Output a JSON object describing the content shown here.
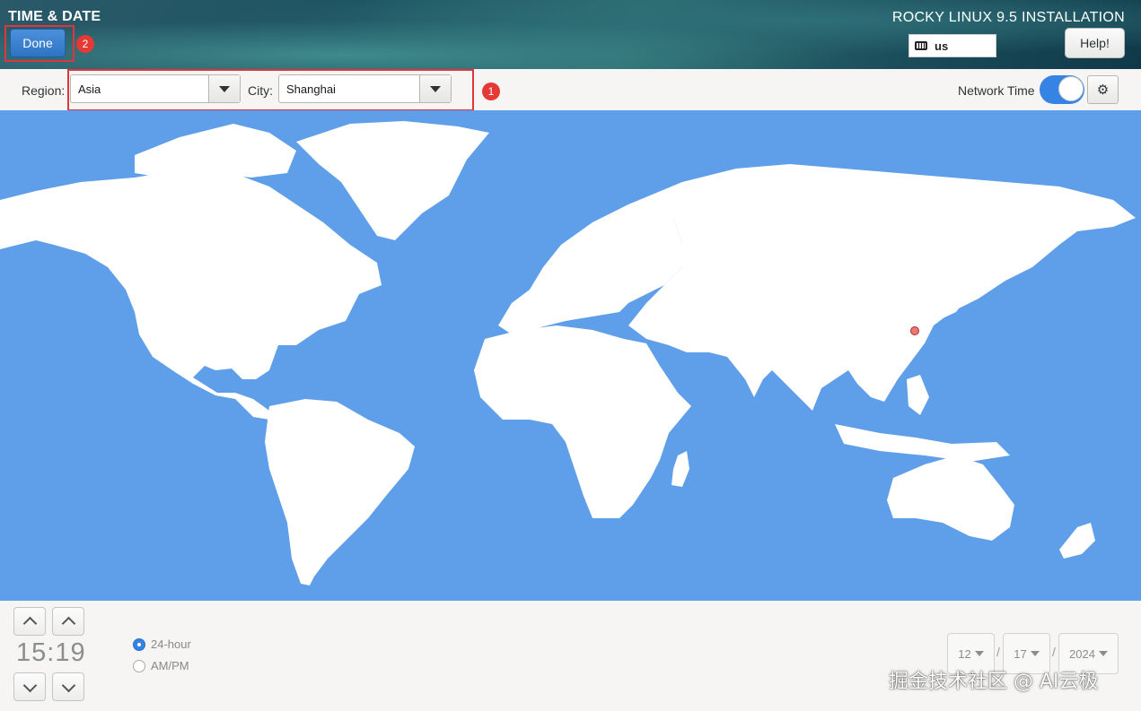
{
  "header": {
    "spoke_title": "TIME & DATE",
    "done_label": "Done",
    "product_title": "ROCKY LINUX 9.5 INSTALLATION",
    "keyboard_layout": "us",
    "keyboard_icon": "keyboard-icon",
    "help_label": "Help!"
  },
  "annotations": {
    "badge_1": "1",
    "badge_2": "2",
    "highlight_color": "#e0353b"
  },
  "toolbar": {
    "region_label": "Region:",
    "region_value": "Asia",
    "city_label": "City:",
    "city_value": "Shanghai",
    "network_time_label": "Network Time",
    "network_time_on": true,
    "settings_icon": "gear-icon"
  },
  "map": {
    "ocean_color": "#5f9ee9",
    "land_color": "#ffffff",
    "marker_city": "Shanghai"
  },
  "time": {
    "display": "15:19",
    "format_24h_label": "24-hour",
    "format_ampm_label": "AM/PM",
    "selected_format": "24-hour"
  },
  "date": {
    "month": "12",
    "day": "17",
    "year": "2024",
    "separator": "/"
  },
  "watermark": "掘金技术社区 @ AI云极"
}
